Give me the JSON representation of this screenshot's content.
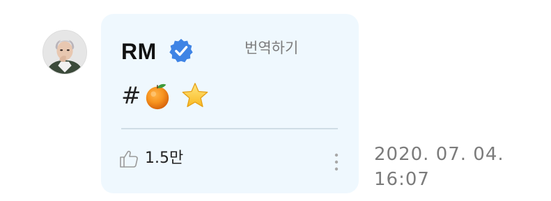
{
  "post": {
    "author": "RM",
    "translate_label": "번역하기",
    "content_text": "#",
    "content_emojis": [
      "tangerine-emoji",
      "star-emoji"
    ],
    "likes": "1.5만",
    "timestamp_line1": "2020. 07. 04.",
    "timestamp_line2": "16:07"
  },
  "icons": {
    "verified": "verified-badge-icon",
    "like": "thumbs-up-icon",
    "more": "more-vertical-icon"
  },
  "colors": {
    "bubble_background": "#eff8fe",
    "verified_badge": "#3f84e5",
    "divider": "#cfdde6",
    "muted_text": "#7b7b7b"
  }
}
